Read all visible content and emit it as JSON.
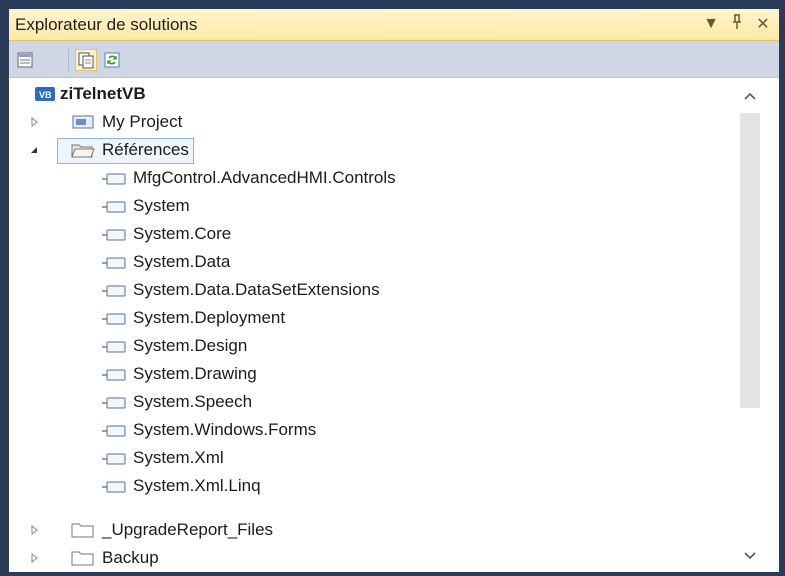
{
  "window": {
    "title": "Explorateur de solutions",
    "actions": [
      "▼",
      "⊥",
      "✕"
    ]
  },
  "toolbar": {
    "buttons": [
      "properties-icon",
      "show-all-files-icon",
      "refresh-icon"
    ]
  },
  "tree": {
    "root": "ziTelnetVB",
    "my_project": "My Project",
    "references": "Références",
    "reference_items": [
      "MfgControl.AdvancedHMI.Controls",
      "System",
      "System.Core",
      "System.Data",
      "System.Data.DataSetExtensions",
      "System.Deployment",
      "System.Design",
      "System.Drawing",
      "System.Speech",
      "System.Windows.Forms",
      "System.Xml",
      "System.Xml.Linq"
    ],
    "folders": [
      "_UpgradeReport_Files",
      "Backup"
    ]
  },
  "colors": {
    "title_bg": "#ffe8a6",
    "toolbar_bg": "#cfd6e5",
    "frame": "#2b3c59",
    "selection_border": "#8fb6e6"
  }
}
